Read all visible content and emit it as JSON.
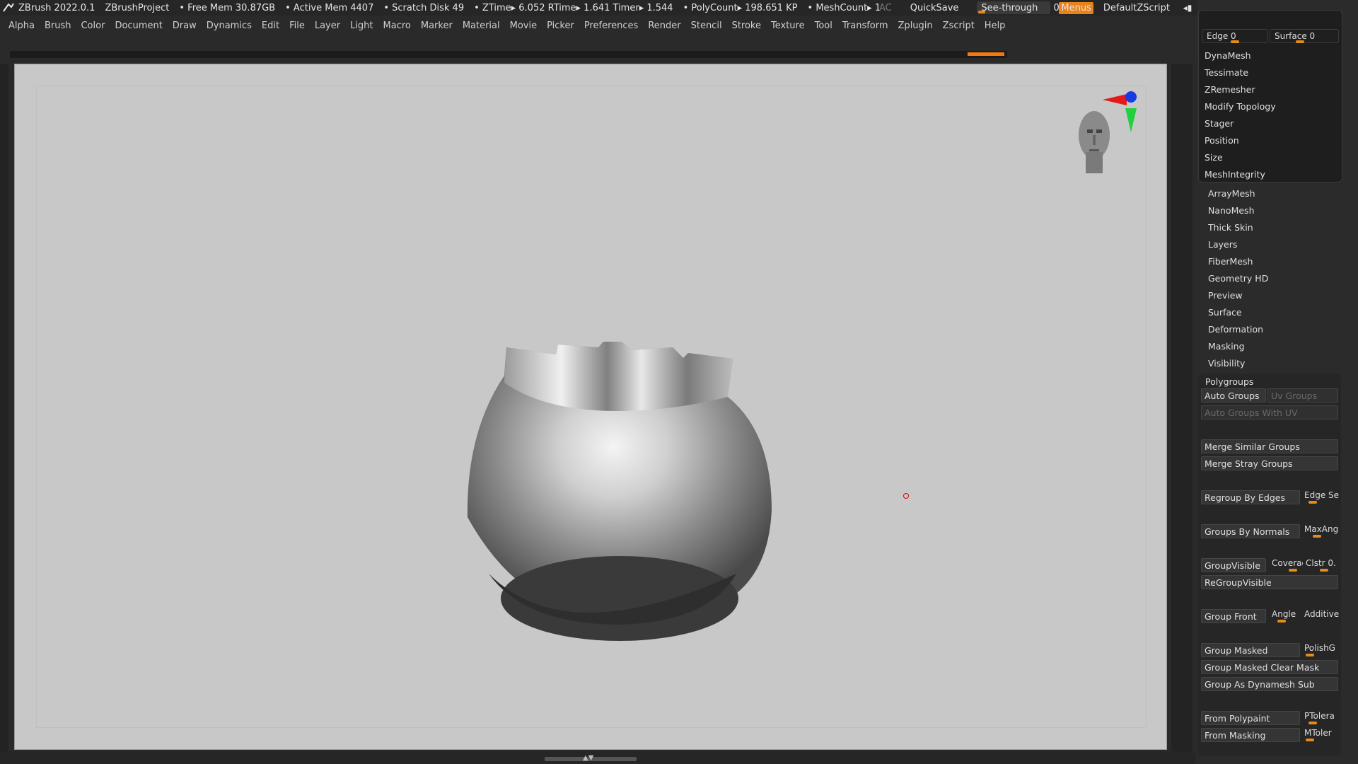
{
  "titlebar": {
    "app": "ZBrush 2022.0.1",
    "project": "ZBrushProject",
    "free_mem": "• Free Mem 30.87GB",
    "active_mem": "• Active Mem 4407",
    "scratch": "• Scratch Disk 49",
    "ztime": "• ZTime▸ 6.052 RTime▸ 1.641 Timer▸ 1.544",
    "polycount": "• PolyCount▸ 198.651 KP",
    "meshcount": "• MeshCount▸ 1",
    "ac": "AC",
    "quicksave": "QuickSave",
    "seethrough_label": "See-through",
    "seethrough_value": "0",
    "menus": "Menus",
    "script": "DefaultZScript"
  },
  "menu": [
    "Alpha",
    "Brush",
    "Color",
    "Document",
    "Draw",
    "Dynamics",
    "Edit",
    "File",
    "Layer",
    "Light",
    "Macro",
    "Marker",
    "Material",
    "Movie",
    "Picker",
    "Preferences",
    "Render",
    "Stencil",
    "Stroke",
    "Texture",
    "Tool",
    "Transform",
    "Zplugin",
    "Zscript",
    "Help"
  ],
  "topology": {
    "edge_label": "Edge 0",
    "surface_label": "Surface 0",
    "items": [
      "DynaMesh",
      "Tessimate",
      "ZRemesher",
      "Modify Topology",
      "Stager",
      "Position",
      "Size",
      "MeshIntegrity"
    ]
  },
  "subpalettes": [
    "ArrayMesh",
    "NanoMesh",
    "Thick Skin",
    "Layers",
    "FiberMesh",
    "Geometry HD",
    "Preview",
    "Surface",
    "Deformation",
    "Masking",
    "Visibility"
  ],
  "polygroups": {
    "title": "Polygroups",
    "auto_groups": "Auto Groups",
    "uv_groups": "Uv Groups",
    "auto_groups_uv": "Auto Groups With UV",
    "merge_similar": "Merge Similar Groups",
    "merge_stray": "Merge Stray Groups",
    "regroup_edges": "Regroup By Edges",
    "edge_se": "Edge Se",
    "groups_normals": "Groups By Normals",
    "maxang": "MaxAng",
    "group_visible": "GroupVisible",
    "coverage": "Coverag",
    "clstr": "Clstr 0.",
    "regroup_visible": "ReGroupVisible",
    "group_front": "Group Front",
    "angle": "Angle",
    "additive": "Additive",
    "group_masked": "Group Masked",
    "polishg": "PolishG",
    "group_masked_clear": "Group Masked Clear Mask",
    "group_dynamesh": "Group As Dynamesh Sub",
    "from_polypaint": "From Polypaint",
    "ptolera": "PTolera",
    "from_masking": "From Masking",
    "mtolera": "MToler"
  }
}
